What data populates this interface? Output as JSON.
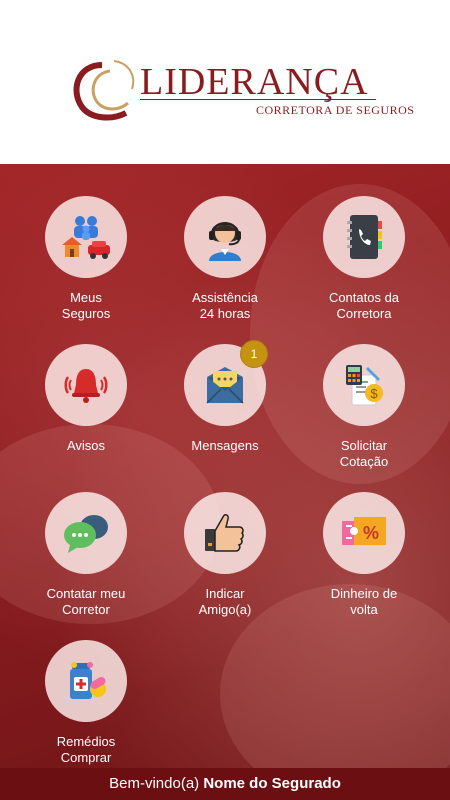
{
  "brand": {
    "name": "LIDERANÇA",
    "tagline": "CORRETORA DE SEGUROS"
  },
  "menu": [
    {
      "label_line1": "Meus",
      "label_line2": "Seguros",
      "icon": "family-house-car-icon"
    },
    {
      "label_line1": "Assistência",
      "label_line2": "24 horas",
      "icon": "headset-agent-icon"
    },
    {
      "label_line1": "Contatos da",
      "label_line2": "Corretora",
      "icon": "phone-book-icon"
    },
    {
      "label_line1": "Avisos",
      "label_line2": "",
      "icon": "bell-icon"
    },
    {
      "label_line1": "Mensagens",
      "label_line2": "",
      "icon": "envelope-icon",
      "badge": "1"
    },
    {
      "label_line1": "Solicitar",
      "label_line2": "Cotação",
      "icon": "calculator-quote-icon"
    },
    {
      "label_line1": "Contatar meu",
      "label_line2": "Corretor",
      "icon": "chat-bubbles-icon"
    },
    {
      "label_line1": "Indicar",
      "label_line2": "Amigo(a)",
      "icon": "thumbs-up-icon"
    },
    {
      "label_line1": "Dinheiro de",
      "label_line2": "volta",
      "icon": "percent-ticket-icon"
    },
    {
      "label_line1": "Remédios",
      "label_line2": "Comprar",
      "icon": "medicine-icon"
    }
  ],
  "footer": {
    "greeting": "Bem-vindo(a)",
    "user_name": "Nome do Segurado"
  },
  "colors": {
    "brand": "#8a1c1f",
    "badge": "#c69212",
    "footer": "#6c0f12"
  }
}
